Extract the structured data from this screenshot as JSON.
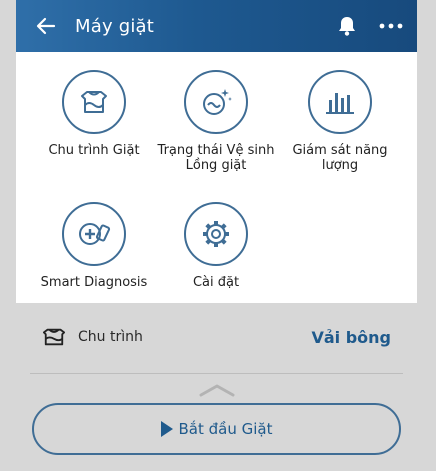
{
  "header": {
    "title": "Máy giặt",
    "back_icon": "arrow-left-icon",
    "bell_icon": "bell-icon",
    "more_icon": "more-horizontal-icon"
  },
  "tiles": [
    {
      "label": "Chu trình Giặt",
      "icon": "laundry-basket-icon"
    },
    {
      "label": "Trạng thái Vệ sinh Lồng giặt",
      "icon": "tub-clean-icon"
    },
    {
      "label": "Giám sát năng lượng",
      "icon": "bar-chart-icon"
    },
    {
      "label": "Smart Diagnosis",
      "icon": "smart-diagnosis-icon"
    },
    {
      "label": "Cài đặt",
      "icon": "gear-icon"
    }
  ],
  "cycle": {
    "label": "Chu trình",
    "value": "Vải bông",
    "icon": "laundry-basket-icon"
  },
  "start_button": {
    "label": "Bắt đầu Giặt",
    "icon": "play-icon"
  },
  "colors": {
    "accent": "#1f5a8c",
    "header": "#1e5990",
    "icon_stroke": "#3f6d95"
  }
}
